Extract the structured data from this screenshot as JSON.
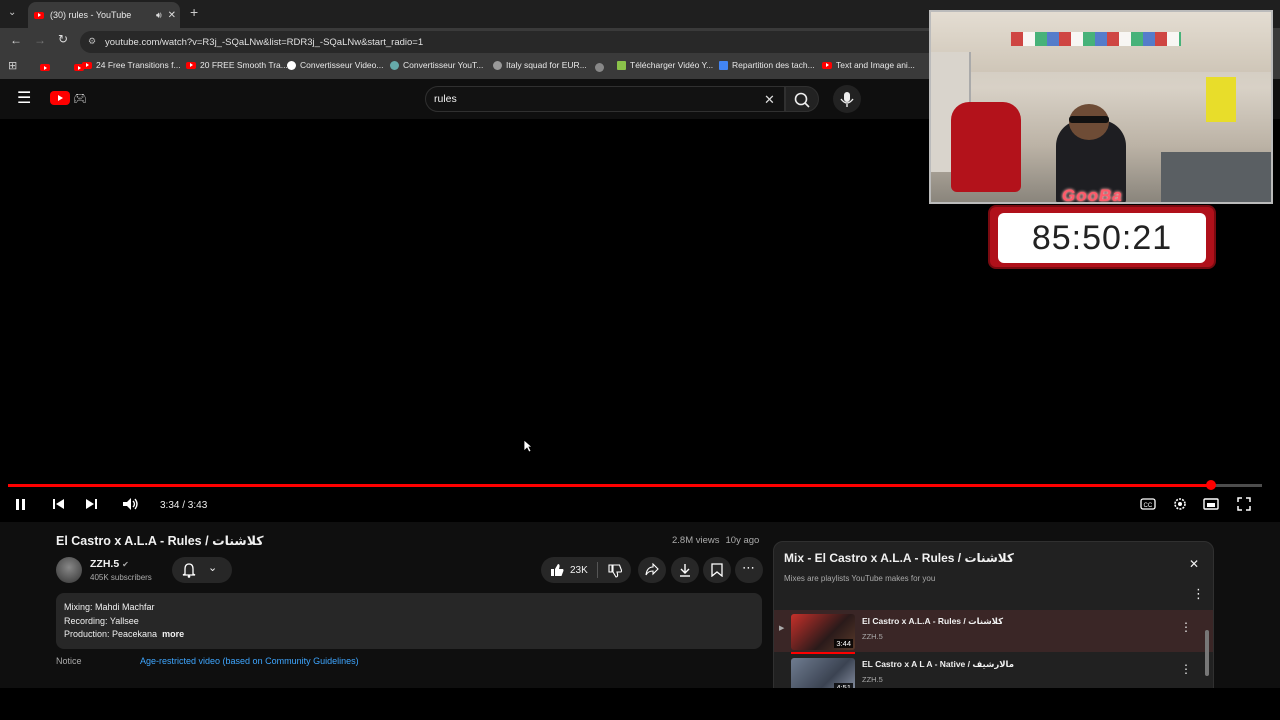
{
  "browser": {
    "tab_title": "(30) rules - YouTube",
    "url": "youtube.com/watch?v=R3j_-SQaLNw&list=RDR3j_-SQaLNw&start_radio=1",
    "bookmarks": [
      "24 Free Transitions f...",
      "20 FREE Smooth Tra...",
      "Convertisseur Video...",
      "Convertisseur YouT...",
      "Italy squad for EUR...",
      "Télécharger Vidéo Y...",
      "Repartition des tach...",
      "Text and Image ani..."
    ]
  },
  "search": {
    "query": "rules"
  },
  "player": {
    "time": "3:34 / 3:43",
    "progress_fraction": 0.9596
  },
  "overlay": {
    "streamer_name": "GooBa",
    "timer": "85:50:21"
  },
  "video": {
    "title": "El Castro x A.L.A - Rules / كلاشنات",
    "views": "2.8M views",
    "age": "10y ago",
    "channel_name": "ZZH.5",
    "subscribers": "405K subscribers",
    "likes": "23K",
    "description_lines": [
      "Mixing: Mahdi Machfar",
      "Recording: Yallsee",
      "Production: Peacekana"
    ],
    "more_label": "more",
    "notice_label": "Notice",
    "notice_link": "Age-restricted video (based on Community Guidelines)"
  },
  "playlist": {
    "title": "Mix - El Castro x A.L.A - Rules / كلاشنات",
    "subtitle": "Mixes are playlists YouTube makes for you",
    "items": [
      {
        "title": "El Castro x A.L.A - Rules / كلاشنات",
        "channel": "ZZH.5",
        "duration": "3:44"
      },
      {
        "title": "EL Castro x A L A - Native / مالارشيف",
        "channel": "ZZH.5",
        "duration": "4:51"
      }
    ]
  },
  "colors": {
    "accent": "#ff0000",
    "background": "#0f0f0f",
    "link": "#3ea6ff"
  }
}
